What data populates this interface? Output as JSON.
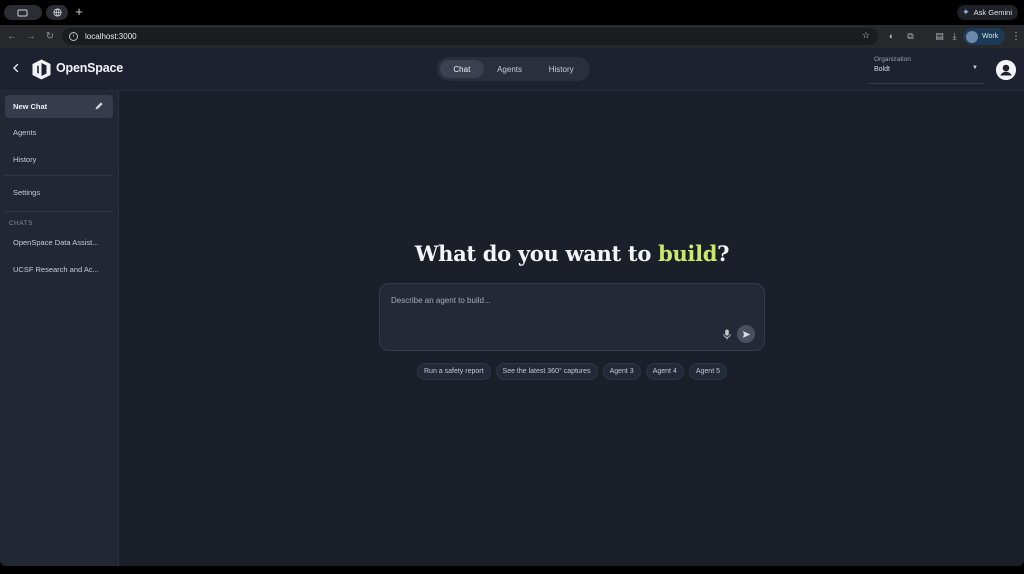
{
  "browser": {
    "gemini_label": "Ask Gemini",
    "url": "localhost:3000",
    "profile_label": "Work"
  },
  "header": {
    "brand": "OpenSpace",
    "tabs": [
      {
        "label": "Chat",
        "active": true
      },
      {
        "label": "Agents",
        "active": false
      },
      {
        "label": "History",
        "active": false
      }
    ],
    "org_label": "Organization",
    "org_value": "Boldt"
  },
  "sidebar": {
    "new_chat": "New Chat",
    "items": [
      "Agents",
      "History",
      "Settings"
    ],
    "section_title": "CHATS",
    "chats": [
      "OpenSpace Data Assist...",
      "UCSF Research and Ac..."
    ]
  },
  "main": {
    "headline_prefix": "What do you want to ",
    "headline_accent": "build",
    "headline_suffix": "?",
    "composer_placeholder": "Describe an agent to build...",
    "suggestions": [
      "Run a safety report",
      "See the latest 360° captures",
      "Agent 3",
      "Agent 4",
      "Agent 5"
    ]
  },
  "colors": {
    "accent_green": "#c9ea6e",
    "background": "#1b1f2a",
    "sidebar": "#222734"
  }
}
